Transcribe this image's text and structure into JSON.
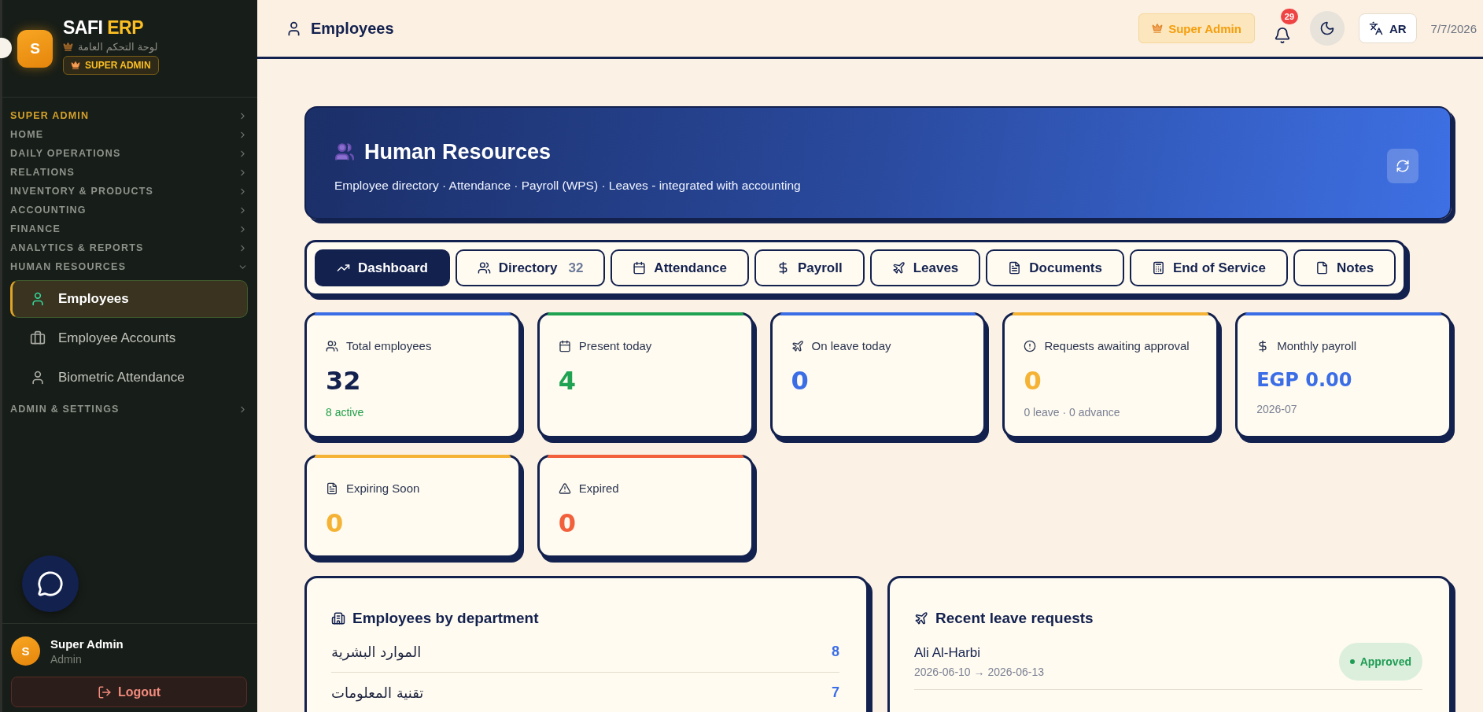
{
  "sidebar": {
    "brand": {
      "logo_letter": "S",
      "name": "SAFI",
      "name_accent": "ERP",
      "subtitle": "لوحة التحكم العامة",
      "role_badge": "SUPER ADMIN"
    },
    "sections": [
      {
        "label": "SUPER ADMIN",
        "highlighted": true,
        "expanded": false
      },
      {
        "label": "HOME",
        "highlighted": false,
        "expanded": false
      },
      {
        "label": "DAILY OPERATIONS",
        "highlighted": false,
        "expanded": false
      },
      {
        "label": "RELATIONS",
        "highlighted": false,
        "expanded": false
      },
      {
        "label": "INVENTORY & PRODUCTS",
        "highlighted": false,
        "expanded": false
      },
      {
        "label": "ACCOUNTING",
        "highlighted": false,
        "expanded": false
      },
      {
        "label": "FINANCE",
        "highlighted": false,
        "expanded": false
      },
      {
        "label": "ANALYTICS & REPORTS",
        "highlighted": false,
        "expanded": false
      },
      {
        "label": "HUMAN RESOURCES",
        "highlighted": false,
        "expanded": true,
        "children": [
          {
            "label": "Employees",
            "selected": true
          },
          {
            "label": "Employee Accounts",
            "selected": false
          },
          {
            "label": "Biometric Attendance",
            "selected": false
          }
        ]
      },
      {
        "label": "ADMIN & SETTINGS",
        "highlighted": false,
        "expanded": false
      }
    ],
    "user": {
      "avatar_letter": "S",
      "name": "Super Admin",
      "role": "Admin"
    },
    "logout": "Logout"
  },
  "header": {
    "title": "Employees",
    "role_badge": "Super Admin",
    "notifications": "29",
    "language": "AR",
    "date": "7/7/2026"
  },
  "banner": {
    "title": "Human Resources",
    "subtitle": "Employee directory · Attendance · Payroll (WPS) · Leaves - integrated with accounting"
  },
  "tabs": [
    {
      "label": "Dashboard",
      "selected": true
    },
    {
      "label": "Directory",
      "count": "32",
      "selected": false
    },
    {
      "label": "Attendance",
      "selected": false
    },
    {
      "label": "Payroll",
      "selected": false
    },
    {
      "label": "Leaves",
      "selected": false
    },
    {
      "label": "Documents",
      "selected": false
    },
    {
      "label": "End of Service",
      "selected": false
    },
    {
      "label": "Notes",
      "selected": false
    }
  ],
  "stats": [
    {
      "label": "Total employees",
      "value": "32",
      "kind": "headline",
      "note": "8 active",
      "color": "#3b6ee6"
    },
    {
      "label": "Present today",
      "value": "4",
      "kind": "metric",
      "color": "#1fa352"
    },
    {
      "label": "On leave today",
      "value": "0",
      "kind": "metric",
      "color": "#3b6ee6"
    },
    {
      "label": "Requests awaiting approval",
      "value": "0",
      "kind": "metric",
      "note": "0 leave · 0 advance",
      "color": "#f5b335"
    },
    {
      "label": "Monthly payroll",
      "value": "EGP 0.00",
      "kind": "amount",
      "note": "2026-07",
      "color": "#3b6ee6"
    },
    {
      "label": "Expiring Soon",
      "value": "0",
      "kind": "metric",
      "color": "#f5b335"
    },
    {
      "label": "Expired",
      "value": "0",
      "kind": "metric",
      "color": "#f2603c"
    }
  ],
  "panels": {
    "departments": {
      "title": "Employees by department",
      "rows": [
        {
          "name": "الموارد البشرية",
          "count": "8"
        },
        {
          "name": "تقنية المعلومات",
          "count": "7"
        }
      ]
    },
    "leave_requests": {
      "title": "Recent leave requests",
      "rows": [
        {
          "employee": "Ali Al-Harbi",
          "dates": "2026-06-10 → 2026-06-13",
          "status": "Approved",
          "kind": "approved"
        }
      ]
    }
  }
}
